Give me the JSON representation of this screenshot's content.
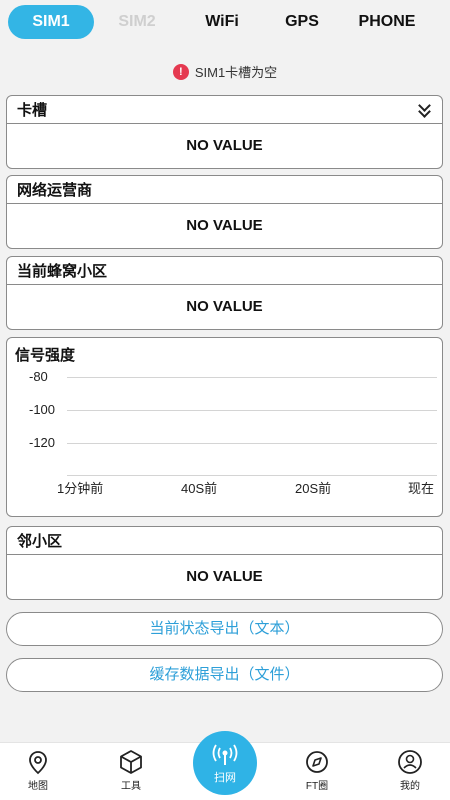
{
  "tabs": {
    "sim1": "SIM1",
    "sim2": "SIM2",
    "wifi": "WiFi",
    "gps": "GPS",
    "phone": "PHONE"
  },
  "alert": {
    "icon": "!",
    "text": "SIM1卡槽为空"
  },
  "cards": {
    "slot": {
      "title": "卡槽",
      "value": "NO VALUE"
    },
    "operator": {
      "title": "网络运营商",
      "value": "NO VALUE"
    },
    "cell": {
      "title": "当前蜂窝小区",
      "value": "NO VALUE"
    },
    "neighbor": {
      "title": "邻小区",
      "value": "NO VALUE"
    }
  },
  "signal": {
    "title": "信号强度",
    "y_ticks": [
      "-80",
      "-100",
      "-120"
    ],
    "x_ticks": [
      "1分钟前",
      "40S前",
      "20S前",
      "现在"
    ]
  },
  "export": {
    "text_label": "当前状态导出（文本）",
    "file_label": "缓存数据导出（文件）"
  },
  "nav": {
    "map": "地图",
    "tools": "工具",
    "scan": "扫网",
    "ft": "FT圈",
    "me": "我的"
  },
  "colors": {
    "accent": "#33b5e5",
    "alert": "#e53950",
    "link": "#2d9fd8"
  }
}
